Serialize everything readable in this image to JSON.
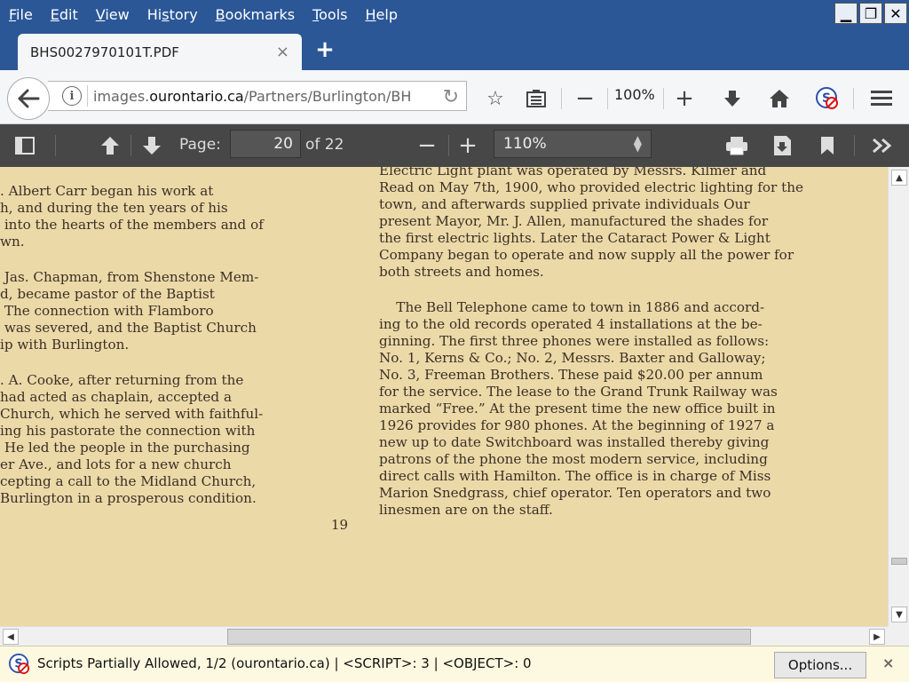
{
  "menu": {
    "items": [
      {
        "label": "File",
        "u": "F",
        "rest": "ile"
      },
      {
        "label": "Edit",
        "u": "E",
        "rest": "dit"
      },
      {
        "label": "View",
        "u": "V",
        "rest": "iew"
      },
      {
        "label": "History",
        "u": "",
        "rest": "Hi",
        "u2": "s",
        "rest2": "tory"
      },
      {
        "label": "Bookmarks",
        "u": "B",
        "rest": "ookmarks"
      },
      {
        "label": "Tools",
        "u": "T",
        "rest": "ools"
      },
      {
        "label": "Help",
        "u": "H",
        "rest": "elp"
      }
    ]
  },
  "tab": {
    "title": "BHS0027970101T.PDF",
    "close": "×",
    "new_tab": "+"
  },
  "nav": {
    "url_prefix": "images.",
    "url_domain": "ourontario.ca",
    "url_path": "/Partners/Burlington/BH",
    "zoom": "100%",
    "zoom_out": "−",
    "zoom_in": "+"
  },
  "pdf_toolbar": {
    "page_label": "Page:",
    "page_value": "20",
    "page_of": "of 22",
    "zoom_out": "−",
    "zoom_in": "+",
    "zoom_select": "110%"
  },
  "document": {
    "left_column": [
      [
        ". Albert Carr began his work at",
        "h, and during the ten years of his",
        " into the hearts of the members and of",
        "wn."
      ],
      [
        " Jas. Chapman, from Shenstone Mem-",
        "d, became pastor of the Baptist",
        " The connection with Flamboro",
        " was severed, and the Baptist Church",
        "ip with Burlington."
      ],
      [
        ". A. Cooke, after returning from the",
        "had acted as chaplain, accepted a",
        "Church, which he served with faithful-",
        "ing his pastorate the connection with",
        " He led the people in the purchasing",
        "er Ave., and lots for a new church",
        "cepting a call to the Midland Church,",
        "Burlington in a prosperous condition."
      ]
    ],
    "right_column": [
      [
        "Electric Light plant was operated by Messrs. Kilmer and",
        "Read on May 7th, 1900, who provided electric lighting for the",
        "town, and afterwards supplied private individuals Our",
        "present Mayor, Mr. J. Allen, manufactured the shades for",
        "the first electric lights. Later the Cataract Power & Light",
        "Company began to operate and now supply all the power for",
        "both streets and homes."
      ],
      [
        "    The Bell Telephone came to town in 1886 and accord-",
        "ing to the old records operated 4 installations at the be-",
        "ginning. The first three phones were installed as follows:",
        "No. 1, Kerns & Co.; No. 2, Messrs. Baxter and Galloway;",
        "No. 3, Freeman Brothers. These paid $20.00 per annum",
        "for the service. The lease to the Grand Trunk Railway was",
        "marked “Free.” At the present time the new office built in",
        "1926 provides for 980 phones. At the beginning of 1927 a",
        "new up to date Switchboard was installed thereby giving",
        "patrons of the phone the most modern service, including",
        "direct calls with Hamilton. The office is in charge of Miss",
        "Marion Snedgrass, chief operator. Ten operators and two",
        "linesmen are on the staff."
      ]
    ],
    "page_number": "19"
  },
  "notification": {
    "message": "Scripts Partially Allowed, 1/2 (ourontario.ca) | <SCRIPT>: 3 | <OBJECT>: 0",
    "options_button": "Options...",
    "close": "×"
  },
  "colors": {
    "titlebar": "#2b5797",
    "paper": "#ecd9a8",
    "pdf_toolbar": "#474747"
  }
}
